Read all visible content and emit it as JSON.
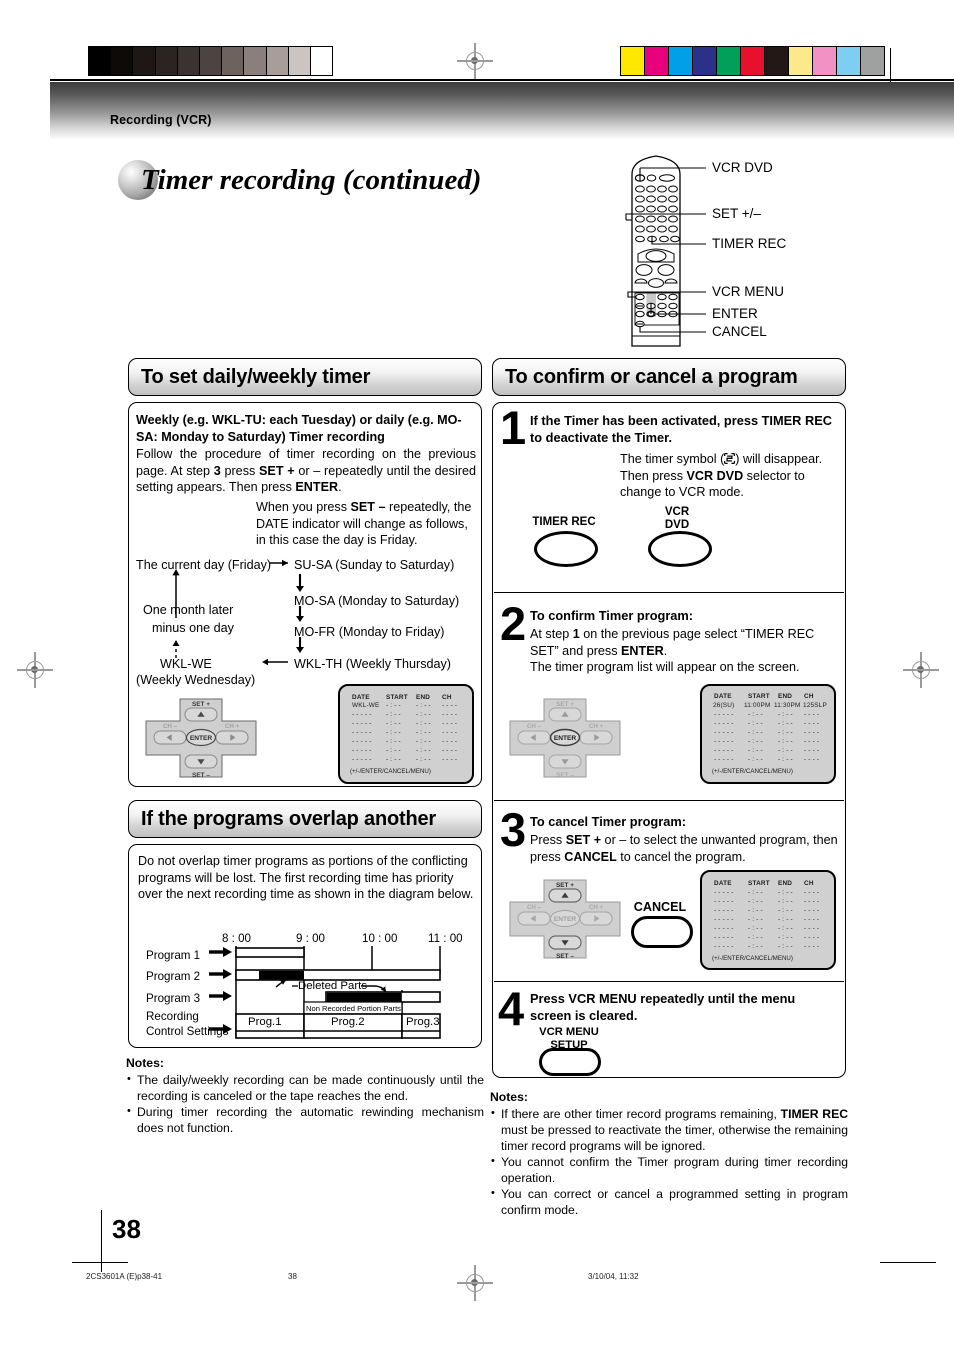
{
  "meta": {
    "breadcrumb": "Recording (VCR)",
    "page_title": "Timer recording (continued)",
    "page_number": "38",
    "footer_left": "2CS3601A (E)p38-41",
    "footer_center": "38",
    "footer_right": "3/10/04, 11:32"
  },
  "colorbars": {
    "grey": [
      "#000000",
      "#0d0a08",
      "#1d1815",
      "#2b2421",
      "#3a3330",
      "#4d4441",
      "#6d625e",
      "#8a7f7b",
      "#a89d99",
      "#ccc4c0",
      "#ffffff"
    ],
    "cmyk": [
      "#ffe800",
      "#e8007d",
      "#00a0e9",
      "#2b3189",
      "#00a05a",
      "#e8112d",
      "#231815",
      "#fbe98a",
      "#f291c4",
      "#7ecef4",
      "#9fa0a0"
    ]
  },
  "remote": {
    "callouts": [
      {
        "label": "VCR DVD"
      },
      {
        "label": "SET +/–"
      },
      {
        "label": "TIMER REC"
      },
      {
        "label": "VCR MENU"
      },
      {
        "label": "ENTER"
      },
      {
        "label": "CANCEL"
      }
    ]
  },
  "left_column": {
    "section1": {
      "heading": "To set daily/weekly timer",
      "intro_bold": "Weekly (e.g. WKL-TU: each Tuesday) or daily (e.g. MO-SA: Monday to Saturday) Timer recording",
      "intro_body_1": "Follow the procedure of timer recording on the previous page. At step ",
      "intro_body_step": "3",
      "intro_body_2": " press ",
      "intro_body_set": "SET +",
      "intro_body_3": " or – repeatedly until the desired setting appears. Then press ",
      "intro_body_enter": "ENTER",
      "intro_body_4": ".",
      "indent_1": "When you press ",
      "indent_set": "SET –",
      "indent_2": " repeatedly, the DATE indicator will change as follows, in this case the day is Friday.",
      "flow": {
        "current_day": "The current day (Friday)",
        "su_sa": "SU-SA (Sunday to Saturday)",
        "mo_sa": "MO-SA (Monday to Saturday)",
        "mo_fr": "MO-FR (Monday to Friday)",
        "wkl_th": "WKL-TH (Weekly Thursday)",
        "wkl_we": "WKL-WE",
        "wkl_we_sub": "(Weekly Wednesday)",
        "one_month_1": "One month later",
        "one_month_2": "minus one day"
      },
      "osd": {
        "headers": [
          "DATE",
          "START",
          "END",
          "CH"
        ],
        "selected_date": "WKL-WE",
        "blank_date": "- - - - -",
        "blank_time": "- : - -",
        "blank_ch": "- - -  -",
        "footer": "(+/-/ENTER/CANCEL/MENU)"
      },
      "dpad": {
        "set_plus": "SET +",
        "set_minus": "SET –",
        "ch_minus": "CH –",
        "ch_plus": "CH +",
        "enter": "ENTER"
      }
    },
    "section2": {
      "heading": "If the programs overlap another",
      "body": "Do not overlap timer programs as portions of the conflicting programs will be lost. The first recording time has priority over the next recording time as shown in the diagram below.",
      "diagram": {
        "times": [
          "8 : 00",
          "9 : 00",
          "10 : 00",
          "11 : 00"
        ],
        "rows": [
          "Program 1",
          "Program 2",
          "Program 3"
        ],
        "control_row_1": "Recording",
        "control_row_2": "Control Settings",
        "blocks": [
          "Prog.1",
          "Prog.2",
          "Prog.3"
        ],
        "annotation_deleted": "Deleted Parts",
        "annotation_nonrecorded": "Non Recorded Portion Parts"
      }
    },
    "notes": {
      "title": "Notes:",
      "items": [
        "The daily/weekly recording can be made continuously until the recording is canceled or the tape reaches the end.",
        "During timer recording the automatic rewinding mechanism does not function."
      ]
    }
  },
  "right_column": {
    "heading": "To confirm or cancel a program",
    "steps": [
      {
        "number": "1",
        "head": "If the Timer has been activated, press TIMER REC to deactivate the Timer.",
        "body_1": "The timer symbol (",
        "body_symbol": "timer-symbol-icon",
        "body_2": ") will disappear. Then press ",
        "body_bold": "VCR DVD",
        "body_3": " selector to change to VCR mode.",
        "buttons": [
          {
            "label": "TIMER REC",
            "shape": "oval"
          },
          {
            "label_1": "VCR",
            "label_2": "DVD",
            "shape": "oval"
          }
        ]
      },
      {
        "number": "2",
        "head": "To confirm Timer program:",
        "body_1": "At step ",
        "body_step": "1",
        "body_2": " on the previous page select “TIMER REC SET” and press ",
        "body_enter": "ENTER",
        "body_3": ".",
        "body_4": "The timer program list will appear on the screen.",
        "osd": {
          "headers": [
            "DATE",
            "START",
            "END",
            "CH"
          ],
          "program_row": [
            "26(SU)",
            "11:00PM",
            "11:30PM",
            "125SLP"
          ],
          "blank_date": "- - - - -",
          "blank_time": "- : - -",
          "blank_ch": "- - -  -",
          "footer": "(+/-/ENTER/CANCEL/MENU)"
        }
      },
      {
        "number": "3",
        "head": "To cancel Timer program:",
        "body_1": "Press ",
        "body_set": "SET +",
        "body_2": " or – to select the unwanted program, then press ",
        "body_cancel": "CANCEL",
        "body_3": " to cancel the program.",
        "button": "CANCEL",
        "osd": {
          "headers": [
            "DATE",
            "START",
            "END",
            "CH"
          ],
          "blank_date": "- - - - -",
          "blank_time": "- : - -",
          "blank_ch": "- - -  -",
          "footer": "(+/-/ENTER/CANCEL/MENU)"
        }
      },
      {
        "number": "4",
        "head": "Press VCR MENU repeatedly until the menu screen is cleared.",
        "button_label_1": "VCR MENU",
        "button_label_2": "SETUP"
      }
    ],
    "notes": {
      "title": "Notes:",
      "items": [
        {
          "pre": "If there are other timer record programs remaining, ",
          "bold": "TIMER REC",
          "post": " must be pressed to reactivate the timer, otherwise the remaining timer record programs will be ignored."
        },
        {
          "pre": "You cannot confirm the Timer program during timer recording operation.",
          "bold": "",
          "post": ""
        },
        {
          "pre": "You can correct or cancel a programmed setting in program confirm mode.",
          "bold": "",
          "post": ""
        }
      ]
    }
  }
}
